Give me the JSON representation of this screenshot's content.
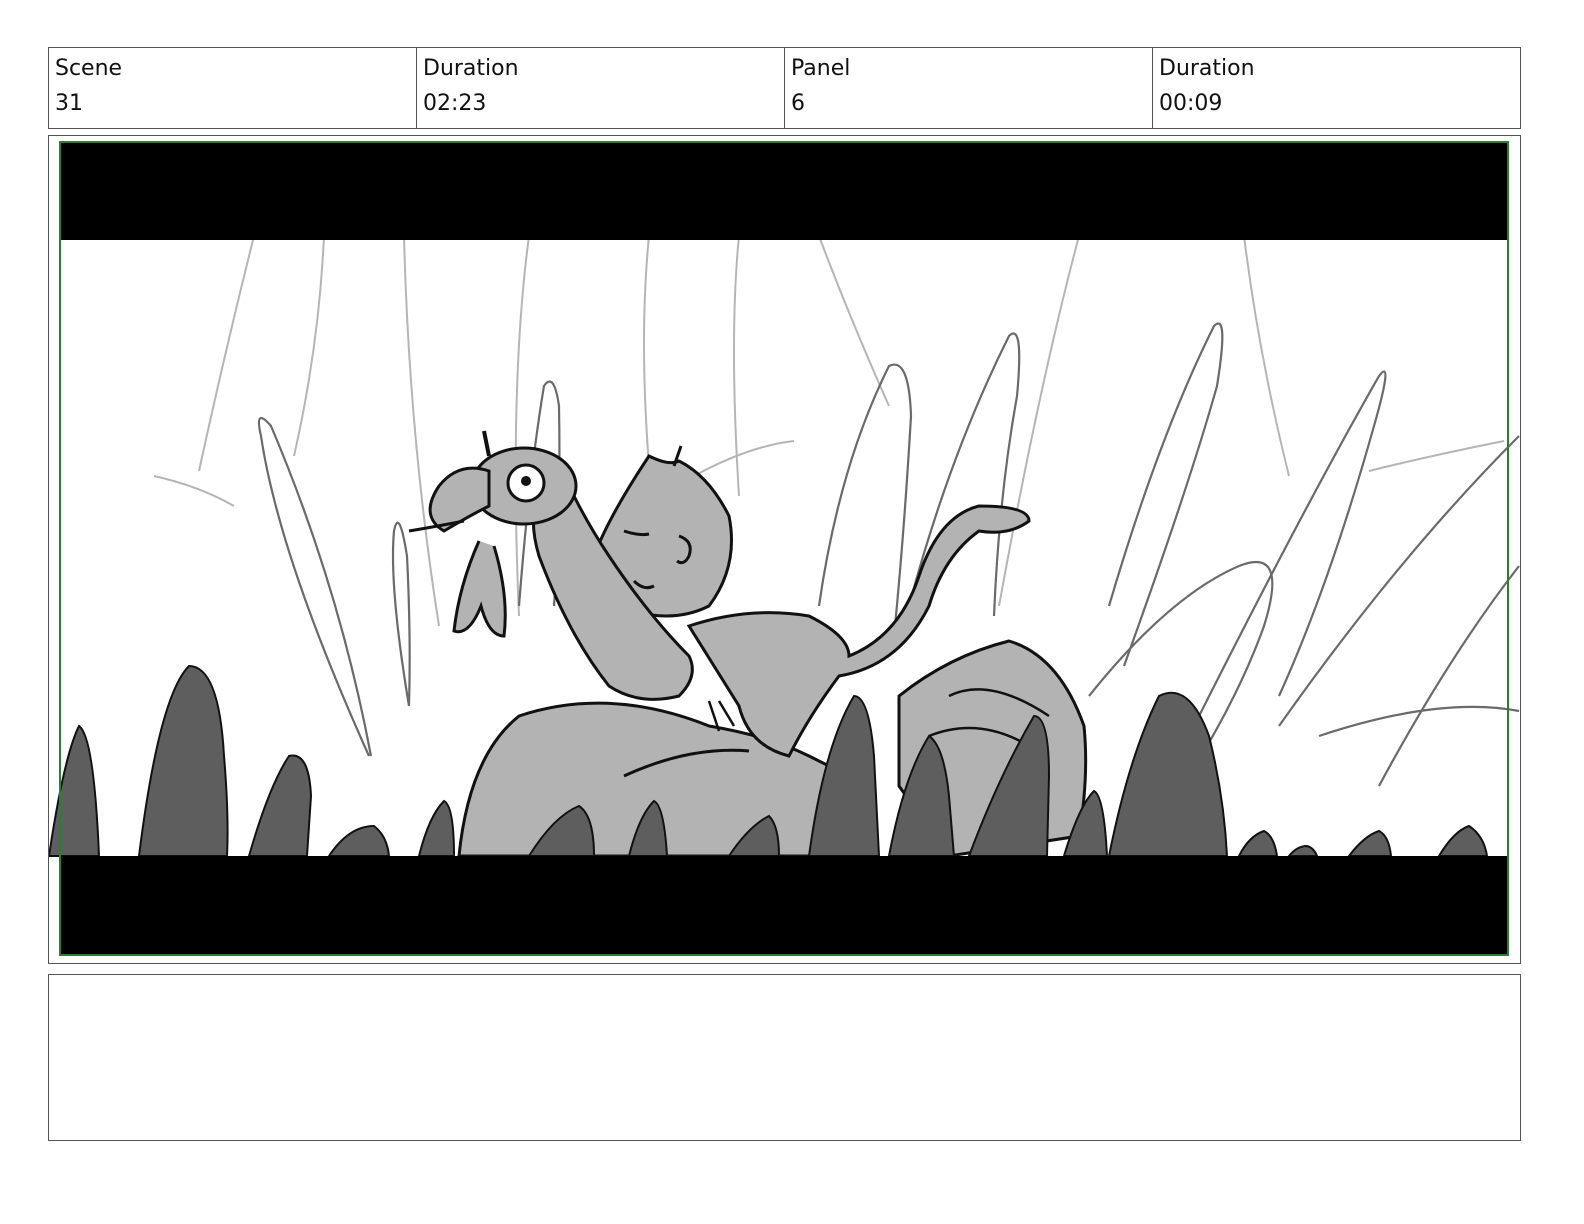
{
  "header": {
    "cells": [
      {
        "label": "Scene",
        "value": "31"
      },
      {
        "label": "Duration",
        "value": "02:23"
      },
      {
        "label": "Panel",
        "value": "6"
      },
      {
        "label": "Duration",
        "value": "00:09"
      }
    ]
  },
  "colors": {
    "border": "#555555",
    "safe_frame": "#2e7d32",
    "letterbox": "#000000",
    "sketch_light": "#b0b0b0",
    "sketch_mid": "#5e5e5e",
    "character_fill": "#b3b3b3"
  },
  "notes": {
    "text": ""
  }
}
